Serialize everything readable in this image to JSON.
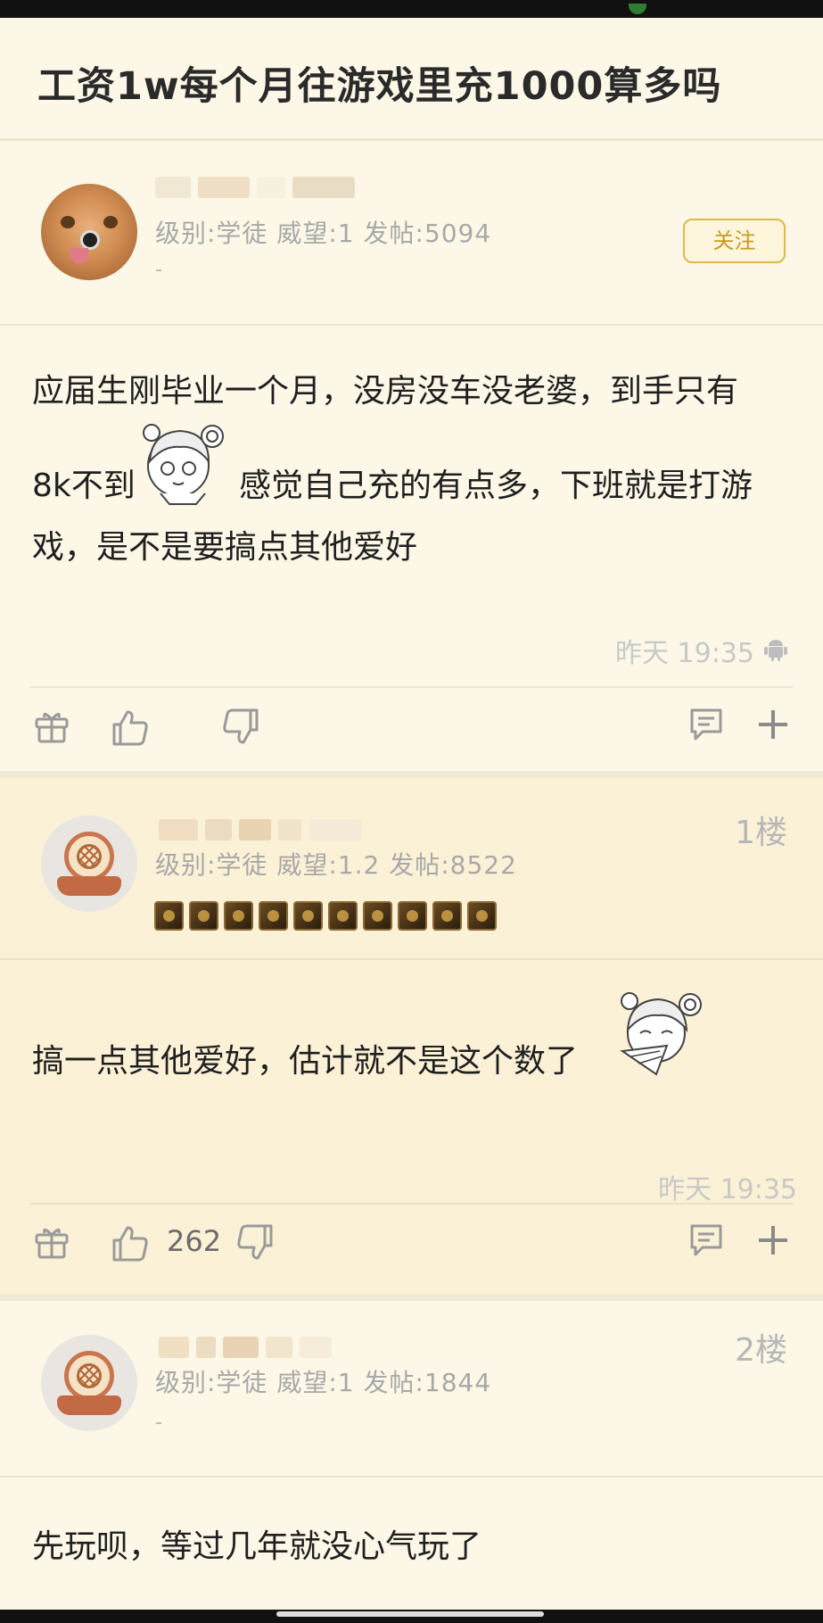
{
  "page": {
    "title": "工资1w每个月往游戏里充1000算多吗"
  },
  "post": {
    "author_meta": "级别:学徒 威望:1 发帖:5094",
    "author_extra": "-",
    "follow_label": "关注",
    "lines": [
      "应届生刚毕业一个月，没房没车没老婆，到手只有",
      "8k不到",
      "感觉自己充的有点多，下班就是打游",
      "戏，是不是要搞点其他爱好"
    ],
    "time": "昨天 19:35",
    "device_icon": "android-icon"
  },
  "replies": [
    {
      "floor": "1楼",
      "author_meta": "级别:学徒 威望:1.2 发帖:8522",
      "badge_count": 10,
      "text": "搞一点其他爱好，估计就不是这个数了",
      "time": "昨天 19:35",
      "like_count": "262"
    },
    {
      "floor": "2楼",
      "author_meta": "级别:学徒 威望:1 发帖:1844",
      "author_extra": "-",
      "text": "先玩呗，等过几年就没心气玩了"
    }
  ],
  "icons": [
    "gift-icon",
    "thumbs-up-icon",
    "thumbs-down-icon",
    "comment-icon",
    "plus-icon"
  ],
  "colors": {
    "background": "#fcf6e3",
    "reply_background": "#fbf1d6",
    "accent": "#e0b84a",
    "muted_text": "#a8a8a8"
  }
}
